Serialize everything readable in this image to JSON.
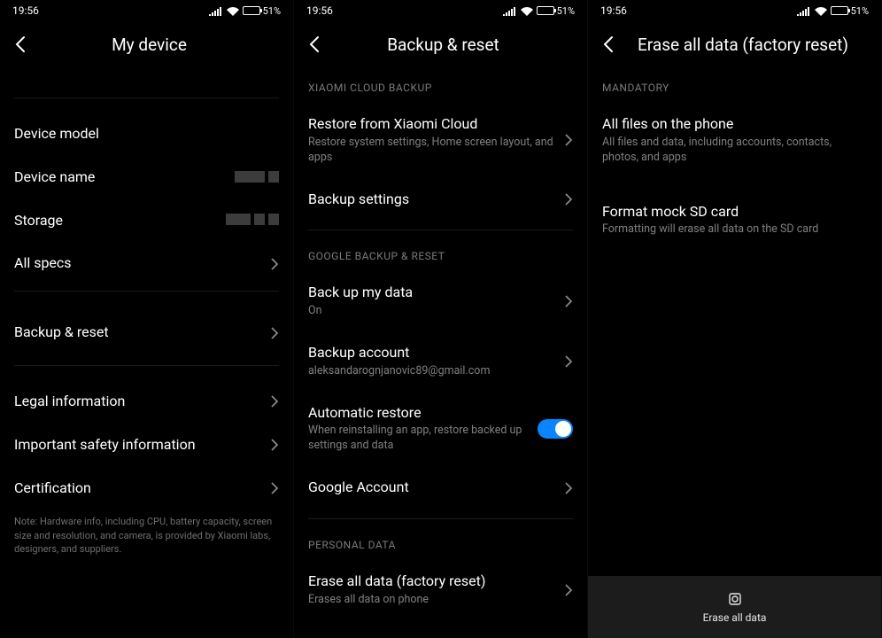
{
  "status": {
    "time": "19:56",
    "battery_pct": "51%"
  },
  "screen1": {
    "title": "My device",
    "items": {
      "device_model": "Device model",
      "device_name": "Device name",
      "storage": "Storage",
      "all_specs": "All specs",
      "backup_reset": "Backup & reset",
      "legal": "Legal information",
      "safety": "Important safety information",
      "certification": "Certification"
    },
    "note": "Note: Hardware info, including CPU, battery capacity, screen size and resolution, and camera, is provided by Xiaomi labs, designers, and suppliers."
  },
  "screen2": {
    "title": "Backup & reset",
    "sections": {
      "xiaomi": "XIAOMI CLOUD BACKUP",
      "google": "GOOGLE BACKUP & RESET",
      "personal": "PERSONAL DATA"
    },
    "restore_xiaomi": {
      "label": "Restore from Xiaomi Cloud",
      "sub": "Restore system settings, Home screen layout, and apps"
    },
    "backup_settings": "Backup settings",
    "backup_my_data": {
      "label": "Back up my data",
      "sub": "On"
    },
    "backup_account": {
      "label": "Backup account",
      "sub": "aleksandarognjanovic89@gmail.com"
    },
    "automatic_restore": {
      "label": "Automatic restore",
      "sub": "When reinstalling an app, restore backed up settings and data"
    },
    "google_account": "Google Account",
    "erase_all": {
      "label": "Erase all data (factory reset)",
      "sub": "Erases all data on phone"
    }
  },
  "screen3": {
    "title": "Erase all data (factory reset)",
    "section_mandatory": "MANDATORY",
    "all_files": {
      "label": "All files on the phone",
      "sub": "All files and data, including accounts, contacts, photos, and apps"
    },
    "format_sd": {
      "label": "Format mock SD card",
      "sub": "Formatting will erase all data on the SD card"
    },
    "erase_button": "Erase all data"
  }
}
